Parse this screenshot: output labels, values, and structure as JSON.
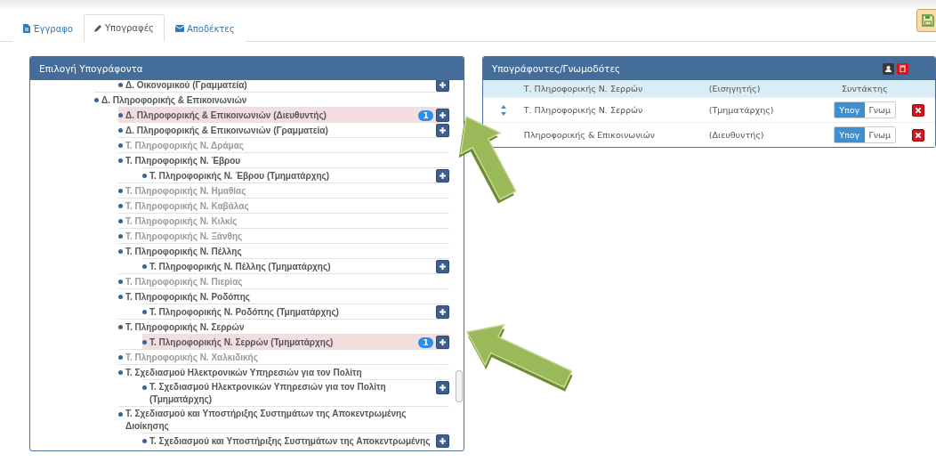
{
  "tabs": [
    {
      "label": "Έγγραφο",
      "kind": "file",
      "selected": false
    },
    {
      "label": "Υπογραφές",
      "kind": "pencil",
      "selected": true
    },
    {
      "label": "Αποδέκτες",
      "kind": "envelope",
      "selected": false
    }
  ],
  "signer_picker": {
    "title": "Επιλογή Υπογράφοντα",
    "tree": [
      {
        "children": [
          {
            "label": "Δ. Οικονομικού (Γραμματεία)",
            "disabled": false,
            "selected": false,
            "addable": true
          }
        ]
      },
      {
        "label": "Δ. Πληροφορικής & Επικοινωνιών",
        "disabled": false,
        "selected": false,
        "addable": false,
        "children": [
          {
            "label": "Δ. Πληροφορικής & Επικοινωνιών (Διευθυντής)",
            "disabled": false,
            "selected": true,
            "badge": "1",
            "addable": true
          },
          {
            "label": "Δ. Πληροφορικής & Επικοινωνιών (Γραμματεία)",
            "disabled": false,
            "selected": false,
            "addable": true
          },
          {
            "label": "Τ. Πληροφορικής Ν. Δράμας",
            "disabled": true,
            "selected": false,
            "addable": false
          },
          {
            "label": "Τ. Πληροφορικής Ν. Έβρου",
            "disabled": false,
            "selected": false,
            "addable": false,
            "children": [
              {
                "label": "Τ. Πληροφορικής Ν. Έβρου (Τμηματάρχης)",
                "disabled": false,
                "selected": false,
                "addable": true
              }
            ]
          },
          {
            "label": "Τ. Πληροφορικής Ν. Ημαθίας",
            "disabled": true,
            "selected": false,
            "addable": false
          },
          {
            "label": "Τ. Πληροφορικής Ν. Καβάλας",
            "disabled": true,
            "selected": false,
            "addable": false
          },
          {
            "label": "Τ. Πληροφορικής Ν. Κιλκίς",
            "disabled": true,
            "selected": false,
            "addable": false
          },
          {
            "label": "Τ. Πληροφορικής Ν. Ξάνθης",
            "disabled": true,
            "selected": false,
            "addable": false
          },
          {
            "label": "Τ. Πληροφορικής Ν. Πέλλης",
            "disabled": false,
            "selected": false,
            "addable": false,
            "children": [
              {
                "label": "Τ. Πληροφορικής Ν. Πέλλης (Τμηματάρχης)",
                "disabled": false,
                "selected": false,
                "addable": true
              }
            ]
          },
          {
            "label": "Τ. Πληροφορικής Ν. Πιερίας",
            "disabled": true,
            "selected": false,
            "addable": false
          },
          {
            "label": "Τ. Πληροφορικής Ν. Ροδόπης",
            "disabled": false,
            "selected": false,
            "addable": false,
            "children": [
              {
                "label": "Τ. Πληροφορικής Ν. Ροδόπης (Τμηματάρχης)",
                "disabled": false,
                "selected": false,
                "addable": true
              }
            ]
          },
          {
            "label": "Τ. Πληροφορικής Ν. Σερρών",
            "disabled": false,
            "selected": false,
            "addable": false,
            "children": [
              {
                "label": "Τ. Πληροφορικής Ν. Σερρών (Τμηματάρχης)",
                "disabled": false,
                "selected": true,
                "badge": "1",
                "addable": true
              }
            ]
          },
          {
            "label": "Τ. Πληροφορικής Ν. Χαλκιδικής",
            "disabled": true,
            "selected": false,
            "addable": false
          },
          {
            "label": "Τ. Σχεδιασμού Ηλεκτρονικών Υπηρεσιών για τον Πολίτη",
            "disabled": false,
            "selected": false,
            "addable": false,
            "children": [
              {
                "label": "Τ. Σχεδιασμού Ηλεκτρονικών Υπηρεσιών για τον Πολίτη (Τμηματάρχης)",
                "disabled": false,
                "selected": false,
                "addable": true
              }
            ]
          },
          {
            "label": "Τ. Σχεδιασμού και Υποστήριξης Συστημάτων της Αποκεντρωμένης Διοίκησης",
            "disabled": false,
            "selected": false,
            "addable": false,
            "children": [
              {
                "label": "Τ. Σχεδιασμού και Υποστήριξης Συστημάτων της Αποκεντρωμένης",
                "disabled": false,
                "selected": false,
                "addable": true
              }
            ]
          }
        ]
      }
    ]
  },
  "signers": {
    "title": "Υπογράφοντες/Γνωμοδότες",
    "header": {
      "name": "Τ. Πληροφορικής Ν. Σερρών",
      "role": "(Εισηγητής)",
      "column_3": "Συντάκτης"
    },
    "rows": [
      {
        "sort_handle": true,
        "name": "Τ. Πληροφορικής Ν. Σερρών",
        "role": "(Τμηματάρχης)",
        "options": [
          {
            "label": "Υπογ",
            "selected": true
          },
          {
            "label": "Γνωμ",
            "selected": false
          }
        ]
      },
      {
        "sort_handle": false,
        "name": "Πληροφορικής & Επικοινωνιών",
        "role": "(Διευθυντής)",
        "options": [
          {
            "label": "Υπογ",
            "selected": true
          },
          {
            "label": "Γνωμ",
            "selected": false
          }
        ]
      }
    ]
  }
}
